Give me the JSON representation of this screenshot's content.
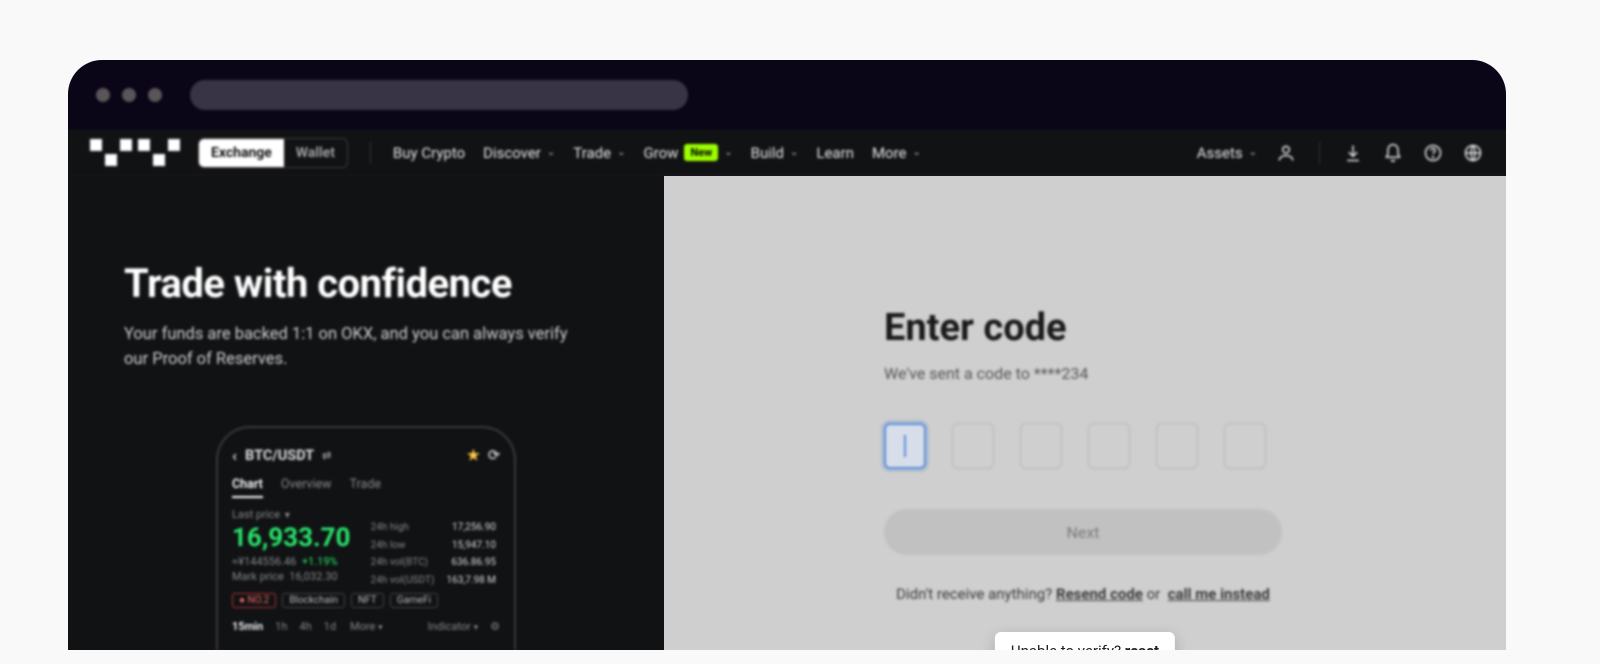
{
  "nav": {
    "toggle": {
      "exchange": "Exchange",
      "wallet": "Wallet"
    },
    "items": [
      {
        "label": "Buy Crypto",
        "dropdown": false
      },
      {
        "label": "Discover",
        "dropdown": true
      },
      {
        "label": "Trade",
        "dropdown": true
      },
      {
        "label": "Grow",
        "dropdown": true,
        "badge": "New"
      },
      {
        "label": "Build",
        "dropdown": true
      },
      {
        "label": "Learn",
        "dropdown": false
      },
      {
        "label": "More",
        "dropdown": true
      }
    ],
    "assets": "Assets"
  },
  "hero": {
    "title": "Trade with confidence",
    "subtitle": "Your funds are backed 1:1 on OKX, and you can always verify our Proof of Reserves."
  },
  "phone": {
    "pair": "BTC/USDT",
    "tabs": {
      "chart": "Chart",
      "overview": "Overview",
      "trade": "Trade"
    },
    "last_price_label": "Last price",
    "price": "16,933.70",
    "approx": "≈¥144556.46",
    "change": "+1.19%",
    "mark_label": "Mark price",
    "mark_value": "16,032.30",
    "stats": {
      "high_label": "24h high",
      "high": "17,256.90",
      "low_label": "24h low",
      "low": "15,947.10",
      "volbtc_label": "24h vol(BTC)",
      "volbtc": "636.86.95",
      "volusdt_label": "24h vol(USDT)",
      "volusdt": "163,7.98 M"
    },
    "chips": [
      "NO.2",
      "Blockchain",
      "NFT",
      "GameFi"
    ],
    "timeframes": {
      "t15": "15min",
      "t1h": "1h",
      "t4h": "4h",
      "t1d": "1d",
      "more": "More",
      "indicator": "Indicator"
    }
  },
  "code": {
    "title": "Enter code",
    "sent_prefix": "We've sent a code to ",
    "sent_mask": "****234",
    "next": "Next",
    "help_prefix": "Didn't receive anything? ",
    "resend": "Resend code",
    "or": " or ",
    "call": "call me instead",
    "tooltip_prefix": "Unable to verify? ",
    "tooltip_link": "reset"
  }
}
